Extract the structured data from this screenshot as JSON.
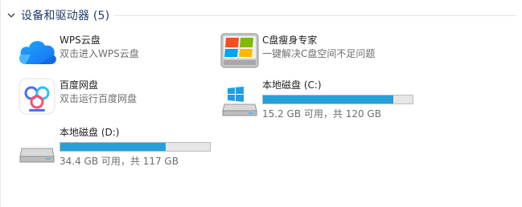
{
  "group": {
    "title": "设备和驱动器 (5)"
  },
  "items": [
    {
      "name": "WPS云盘",
      "subtitle": "双击进入WPS云盘",
      "icon": "wps-cloud-icon"
    },
    {
      "name": "C盘瘦身专家",
      "subtitle": "一键解决C盘空间不足问题",
      "icon": "c-drive-cleaner-icon"
    },
    {
      "name": "百度网盘",
      "subtitle": "双击运行百度网盘",
      "icon": "baidu-netdisk-icon"
    },
    {
      "name": "本地磁盘 (C:)",
      "subtitle": "15.2 GB 可用，共 120 GB",
      "icon": "windows-drive-icon",
      "used_fraction": 0.873
    },
    {
      "name": "本地磁盘 (D:)",
      "subtitle": "34.4 GB 可用，共 117 GB",
      "icon": "hard-drive-icon",
      "used_fraction": 0.706
    }
  ],
  "colors": {
    "bar_fill": "#26a0da",
    "bar_track": "#e6e6e6",
    "header_text": "#1e3d6b"
  }
}
